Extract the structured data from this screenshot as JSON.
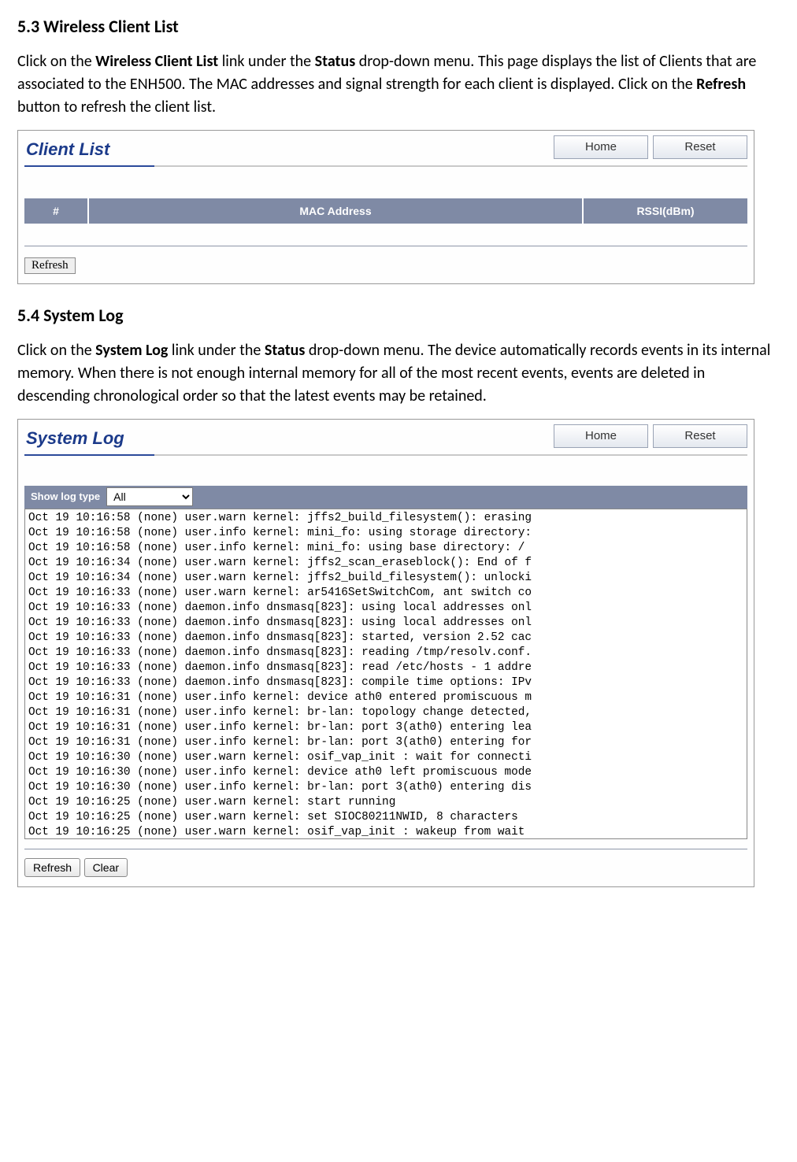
{
  "section53": {
    "heading": "5.3 Wireless Client List",
    "paragraph_parts": {
      "p1": "Click on the ",
      "b1": "Wireless Client List",
      "p2": " link under the ",
      "b2": "Status",
      "p3": " drop-down menu. This page displays the list of Clients that are associated to the ENH500. The MAC addresses and signal strength for each client is displayed. Click on the ",
      "b3": "Refresh",
      "p4": " button to refresh the client list."
    }
  },
  "clientList": {
    "title": "Client List",
    "buttons": {
      "home": "Home",
      "reset": "Reset"
    },
    "columns": {
      "num": "#",
      "mac": "MAC Address",
      "rssi": "RSSI(dBm)"
    },
    "refresh": "Refresh"
  },
  "section54": {
    "heading": "5.4 System Log",
    "paragraph_parts": {
      "p1": "Click on the ",
      "b1": "System Log",
      "p2": " link under the ",
      "b2": "Status",
      "p3": " drop-down menu. The device automatically records events in its internal memory. When there is not enough internal memory for all of the most recent events, events are deleted in descending chronological order so that the latest events may be retained."
    }
  },
  "systemLog": {
    "title": "System Log",
    "buttons": {
      "home": "Home",
      "reset": "Reset"
    },
    "showLogLabel": "Show log type",
    "showLogValue": "All",
    "log": "Oct 19 10:16:58 (none) user.warn kernel: jffs2_build_filesystem(): erasing\nOct 19 10:16:58 (none) user.info kernel: mini_fo: using storage directory:\nOct 19 10:16:58 (none) user.info kernel: mini_fo: using base directory: /\nOct 19 10:16:34 (none) user.warn kernel: jffs2_scan_eraseblock(): End of f\nOct 19 10:16:34 (none) user.warn kernel: jffs2_build_filesystem(): unlocki\nOct 19 10:16:33 (none) user.warn kernel: ar5416SetSwitchCom, ant switch co\nOct 19 10:16:33 (none) daemon.info dnsmasq[823]: using local addresses onl\nOct 19 10:16:33 (none) daemon.info dnsmasq[823]: using local addresses onl\nOct 19 10:16:33 (none) daemon.info dnsmasq[823]: started, version 2.52 cac\nOct 19 10:16:33 (none) daemon.info dnsmasq[823]: reading /tmp/resolv.conf.\nOct 19 10:16:33 (none) daemon.info dnsmasq[823]: read /etc/hosts - 1 addre\nOct 19 10:16:33 (none) daemon.info dnsmasq[823]: compile time options: IPv\nOct 19 10:16:31 (none) user.info kernel: device ath0 entered promiscuous m\nOct 19 10:16:31 (none) user.info kernel: br-lan: topology change detected,\nOct 19 10:16:31 (none) user.info kernel: br-lan: port 3(ath0) entering lea\nOct 19 10:16:31 (none) user.info kernel: br-lan: port 3(ath0) entering for\nOct 19 10:16:30 (none) user.warn kernel: osif_vap_init : wait for connecti\nOct 19 10:16:30 (none) user.info kernel: device ath0 left promiscuous mode\nOct 19 10:16:30 (none) user.info kernel: br-lan: port 3(ath0) entering dis\nOct 19 10:16:25 (none) user.warn kernel: start running\nOct 19 10:16:25 (none) user.warn kernel: set SIOC80211NWID, 8 characters\nOct 19 10:16:25 (none) user.warn kernel: osif_vap_init : wakeup from wait",
    "refresh": "Refresh",
    "clear": "Clear"
  }
}
